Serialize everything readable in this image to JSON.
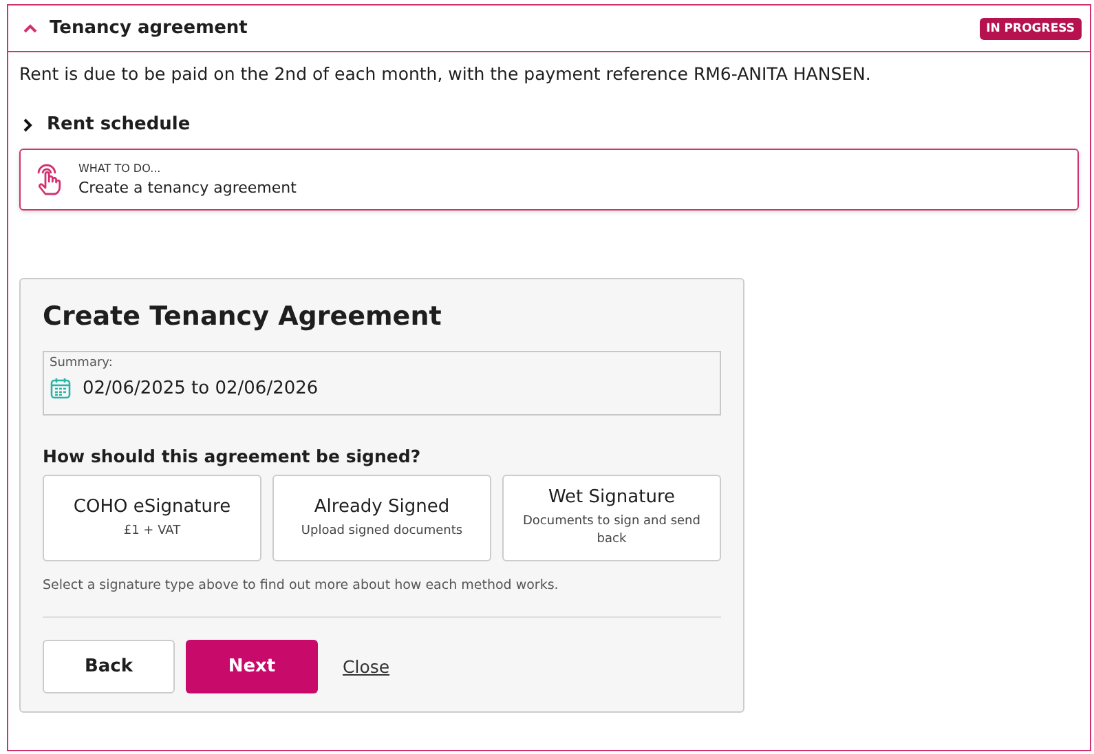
{
  "section": {
    "title": "Tenancy agreement",
    "expanded": true,
    "status": "IN PROGRESS"
  },
  "rent_note": "Rent is due to be paid on the 2nd of each month, with the payment reference RM6-ANITA HANSEN.",
  "rent_schedule": {
    "label": "Rent schedule",
    "expanded": false
  },
  "what_to_do": {
    "label": "WHAT TO DO...",
    "text": "Create a tenancy agreement"
  },
  "form": {
    "title": "Create Tenancy Agreement",
    "summary_label": "Summary:",
    "summary_value": "02/06/2025 to 02/06/2026",
    "question": "How should this agreement be signed?",
    "options": [
      {
        "title": "COHO eSignature",
        "subtitle": "£1 + VAT",
        "selected": false
      },
      {
        "title": "Already Signed",
        "subtitle": "Upload signed documents",
        "selected": false
      },
      {
        "title": "Wet Signature",
        "subtitle": "Documents to sign and send back",
        "selected": false
      }
    ],
    "hint": "Select a signature type above to find out more about how each method works.",
    "buttons": {
      "back": "Back",
      "next": "Next",
      "close": "Close"
    }
  }
}
